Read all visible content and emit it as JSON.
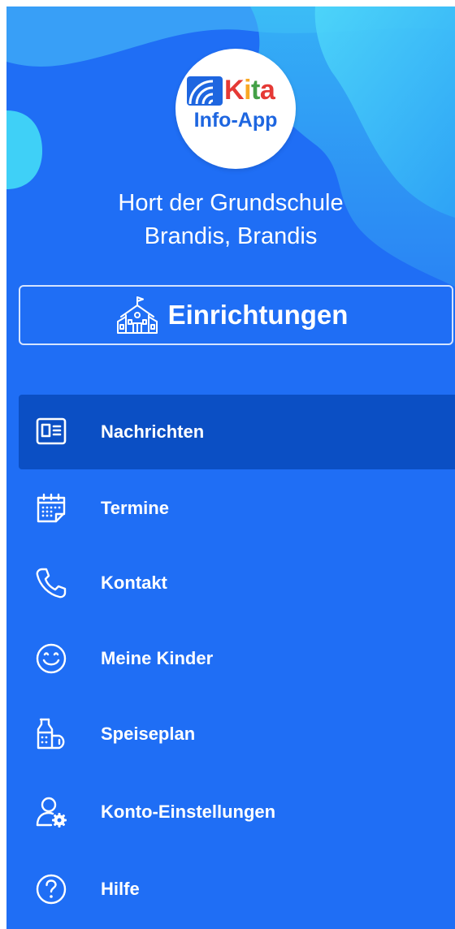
{
  "logo": {
    "kita_letters": [
      "K",
      "i",
      "t",
      "a"
    ],
    "subtitle": "Info-App"
  },
  "institution": {
    "line1": "Hort der Grundschule",
    "line2": "Brandis, Brandis"
  },
  "facilities_button": {
    "label": "Einrichtungen",
    "icon": "school-building-icon"
  },
  "menu": {
    "active": "Nachrichten",
    "items": [
      {
        "label": "Nachrichten",
        "icon": "news-icon"
      },
      {
        "label": "Termine",
        "icon": "calendar-icon"
      },
      {
        "label": "Kontakt",
        "icon": "phone-icon"
      },
      {
        "label": "Meine Kinder",
        "icon": "smiley-icon"
      },
      {
        "label": "Speiseplan",
        "icon": "food-icon"
      },
      {
        "label": "Konto-Einstellungen",
        "icon": "account-settings-icon"
      },
      {
        "label": "Hilfe",
        "icon": "help-icon"
      }
    ]
  },
  "colors": {
    "drawer_background": "#1f6ef5",
    "active_item_background": "#0b4fc4",
    "wave_light": "#3fd0f7",
    "text": "#ffffff",
    "logo_blue": "#1e66e0"
  }
}
